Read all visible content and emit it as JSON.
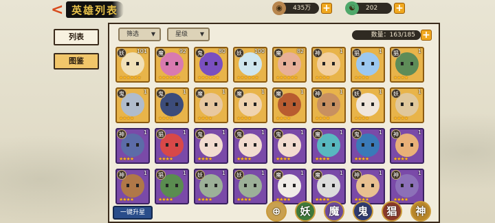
{
  "header": {
    "title": "英雄列表",
    "back_label": "<",
    "resources": [
      {
        "icon": "coin-icon",
        "value": "435万"
      },
      {
        "icon": "jade-icon",
        "value": "202"
      }
    ],
    "plus_label": "+"
  },
  "left_tabs": [
    {
      "label": "列表",
      "active": false
    },
    {
      "label": "图鉴",
      "active": true
    }
  ],
  "filters": {
    "filter_label": "筛选",
    "star_label": "星级",
    "caret": "▼"
  },
  "count": {
    "text": "数量：163/185"
  },
  "star_glyph": "★",
  "heroes": [
    {
      "type": "妖",
      "level": "101",
      "stars": 6,
      "color": "#f0e0b8",
      "rarity": "gold"
    },
    {
      "type": "魔",
      "level": "92",
      "stars": 6,
      "color": "#d87ab0",
      "rarity": "gold"
    },
    {
      "type": "鬼",
      "level": "80",
      "stars": 6,
      "color": "#7a4fc0",
      "rarity": "gold"
    },
    {
      "type": "妖",
      "level": "100",
      "stars": 6,
      "color": "#cfe6ee",
      "rarity": "gold"
    },
    {
      "type": "魔",
      "level": "82",
      "stars": 6,
      "color": "#e8b098",
      "rarity": "gold"
    },
    {
      "type": "神",
      "level": "1",
      "stars": 4,
      "color": "#f2d0a0",
      "rarity": "gold"
    },
    {
      "type": "猖",
      "level": "1",
      "stars": 4,
      "color": "#9cc8f0",
      "rarity": "gold"
    },
    {
      "type": "猖",
      "level": "1",
      "stars": 4,
      "color": "#5e8c58",
      "rarity": "gold"
    },
    {
      "type": "鬼",
      "level": "1",
      "stars": 4,
      "color": "#b0bccc",
      "rarity": "gold"
    },
    {
      "type": "鬼",
      "level": "1",
      "stars": 4,
      "color": "#3c4c7a",
      "rarity": "gold"
    },
    {
      "type": "魔",
      "level": "1",
      "stars": 4,
      "color": "#e8c8a0",
      "rarity": "gold"
    },
    {
      "type": "魔",
      "level": "1",
      "stars": 4,
      "color": "#f0d4b0",
      "rarity": "gold"
    },
    {
      "type": "魔",
      "level": "1",
      "stars": 4,
      "color": "#b85c30",
      "rarity": "gold"
    },
    {
      "type": "神",
      "level": "1",
      "stars": 4,
      "color": "#c89060",
      "rarity": "gold"
    },
    {
      "type": "妖",
      "level": "1",
      "stars": 4,
      "color": "#f0e6dc",
      "rarity": "gold"
    },
    {
      "type": "妖",
      "level": "1",
      "stars": 4,
      "color": "#e0c89c",
      "rarity": "gold"
    },
    {
      "type": "神",
      "level": "1",
      "stars": 4,
      "color": "#5c6ca8",
      "rarity": "purple"
    },
    {
      "type": "猖",
      "level": "1",
      "stars": 4,
      "color": "#d84848",
      "rarity": "purple"
    },
    {
      "type": "鬼",
      "level": "1",
      "stars": 4,
      "color": "#f2dcd0",
      "rarity": "purple"
    },
    {
      "type": "鬼",
      "level": "1",
      "stars": 4,
      "color": "#f2dcd0",
      "rarity": "purple"
    },
    {
      "type": "鬼",
      "level": "1",
      "stars": 4,
      "color": "#f2dcd0",
      "rarity": "purple"
    },
    {
      "type": "魔",
      "level": "1",
      "stars": 4,
      "color": "#58b8c0",
      "rarity": "purple"
    },
    {
      "type": "鬼",
      "level": "1",
      "stars": 4,
      "color": "#3a7ab8",
      "rarity": "purple"
    },
    {
      "type": "神",
      "level": "1",
      "stars": 4,
      "color": "#e8b078",
      "rarity": "purple"
    },
    {
      "type": "神",
      "level": "1",
      "stars": 4,
      "color": "#b07848",
      "rarity": "purple"
    },
    {
      "type": "猖",
      "level": "1",
      "stars": 4,
      "color": "#5a8c50",
      "rarity": "purple"
    },
    {
      "type": "妖",
      "level": "1",
      "stars": 4,
      "color": "#9cb098",
      "rarity": "purple"
    },
    {
      "type": "妖",
      "level": "1",
      "stars": 4,
      "color": "#9cb098",
      "rarity": "purple"
    },
    {
      "type": "魔",
      "level": "1",
      "stars": 4,
      "color": "#f0ece8",
      "rarity": "purple"
    },
    {
      "type": "魔",
      "level": "1",
      "stars": 4,
      "color": "#dcdcdc",
      "rarity": "purple"
    },
    {
      "type": "神",
      "level": "1",
      "stars": 4,
      "color": "#e8c090",
      "rarity": "purple"
    },
    {
      "type": "神",
      "level": "1",
      "stars": 4,
      "color": "#8c70b8",
      "rarity": "purple"
    }
  ],
  "bottom": {
    "upgrade_label": "一键升星",
    "factions": [
      {
        "label": "⊕",
        "name": "all",
        "color": "#c8a050"
      },
      {
        "label": "妖",
        "name": "yao",
        "color": "#3f7a3a"
      },
      {
        "label": "魔",
        "name": "mo",
        "color": "#6a4a9a"
      },
      {
        "label": "鬼",
        "name": "gui",
        "color": "#2f3b70"
      },
      {
        "label": "猖",
        "name": "chang",
        "color": "#8a3a2a"
      },
      {
        "label": "神",
        "name": "shen",
        "color": "#b8862a"
      }
    ]
  }
}
